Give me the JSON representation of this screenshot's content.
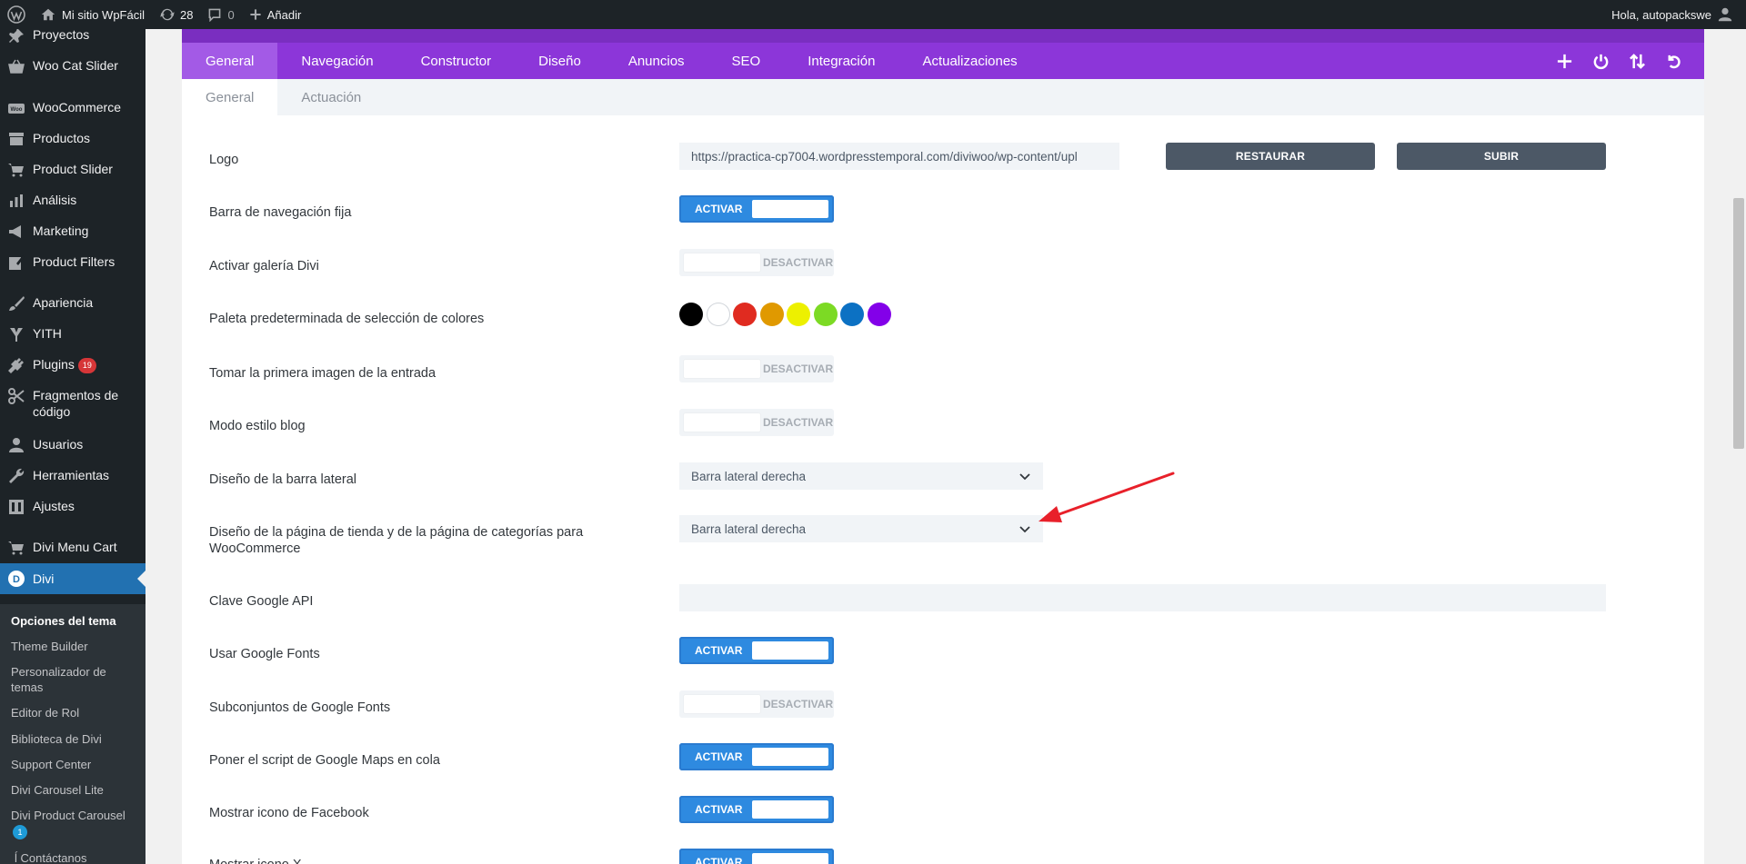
{
  "admin_bar": {
    "site_name": "Mi sitio WpFácil",
    "updates_count": "28",
    "comments_count": "0",
    "add_label": "Añadir",
    "greeting": "Hola, autopackswe"
  },
  "sidebar": {
    "items": [
      {
        "label": "Proyectos",
        "icon": "pin-icon"
      },
      {
        "label": "Woo Cat Slider",
        "icon": "basket-icon"
      },
      {
        "label": "WooCommerce",
        "icon": "woo-icon"
      },
      {
        "label": "Productos",
        "icon": "archive-icon"
      },
      {
        "label": "Product Slider",
        "icon": "cart-icon"
      },
      {
        "label": "Análisis",
        "icon": "bar-chart-icon"
      },
      {
        "label": "Marketing",
        "icon": "megaphone-icon"
      },
      {
        "label": "Product Filters",
        "icon": "edit-icon"
      },
      {
        "label": "Apariencia",
        "icon": "brush-icon"
      },
      {
        "label": "YITH",
        "icon": "yith-icon"
      },
      {
        "label": "Plugins",
        "icon": "plug-icon",
        "badge": "19"
      },
      {
        "label": "Fragmentos de código",
        "icon": "scissors-icon"
      },
      {
        "label": "Usuarios",
        "icon": "user-icon"
      },
      {
        "label": "Herramientas",
        "icon": "wrench-icon"
      },
      {
        "label": "Ajustes",
        "icon": "settings-icon"
      },
      {
        "label": "Divi Menu Cart",
        "icon": "cart-icon"
      },
      {
        "label": "Divi",
        "icon": "divi-icon"
      }
    ],
    "submenu": [
      {
        "label": "Opciones del tema"
      },
      {
        "label": "Theme Builder"
      },
      {
        "label": "Personalizador de temas"
      },
      {
        "label": "Editor de Rol"
      },
      {
        "label": "Biblioteca de Divi"
      },
      {
        "label": "Support Center"
      },
      {
        "label": "Divi Carousel Lite"
      },
      {
        "label": "Divi Product Carousel",
        "badge": "1"
      },
      {
        "label": "ĺ Contáctanos"
      }
    ]
  },
  "tabs": [
    "General",
    "Navegación",
    "Constructor",
    "Diseño",
    "Anuncios",
    "SEO",
    "Integración",
    "Actualizaciones"
  ],
  "subtabs": [
    "General",
    "Actuación"
  ],
  "settings": {
    "logo": {
      "label": "Logo",
      "value": "https://practica-cp7004.wordpresstemporal.com/diviwoo/wp-content/upl",
      "restore": "RESTAURAR",
      "upload": "SUBIR"
    },
    "fixed_nav": {
      "label": "Barra de navegación fija",
      "state": "ACTIVAR"
    },
    "divi_gallery": {
      "label": "Activar galería Divi",
      "state": "DESACTIVAR"
    },
    "color_palette": {
      "label": "Paleta predeterminada de selección de colores",
      "colors": [
        "#000000",
        "#ffffff",
        "#e02b20",
        "#e09900",
        "#edf000",
        "#7cda24",
        "#0c71c3",
        "#8300e9"
      ]
    },
    "first_image": {
      "label": "Tomar la primera imagen de la entrada",
      "state": "DESACTIVAR"
    },
    "blog_style": {
      "label": "Modo estilo blog",
      "state": "DESACTIVAR"
    },
    "sidebar_layout": {
      "label": "Diseño de la barra lateral",
      "value": "Barra lateral derecha"
    },
    "shop_layout": {
      "label": "Diseño de la página de tienda y de la página de categorías para WooCommerce",
      "value": "Barra lateral derecha"
    },
    "google_api": {
      "label": "Clave Google API",
      "value": ""
    },
    "google_fonts": {
      "label": "Usar Google Fonts",
      "state": "ACTIVAR"
    },
    "google_fonts_subsets": {
      "label": "Subconjuntos de Google Fonts",
      "state": "DESACTIVAR"
    },
    "google_maps": {
      "label": "Poner el script de Google Maps en cola",
      "state": "ACTIVAR"
    },
    "facebook_icon": {
      "label": "Mostrar icono de Facebook",
      "state": "ACTIVAR"
    },
    "x_icon": {
      "label": "Mostrar icono X",
      "state": "ACTIVAR"
    }
  },
  "colors": {
    "accent": "#8c36d9",
    "toggle_on": "#2e8ae0",
    "wp_blue": "#2271b1",
    "annotation_arrow": "#e8202a"
  }
}
